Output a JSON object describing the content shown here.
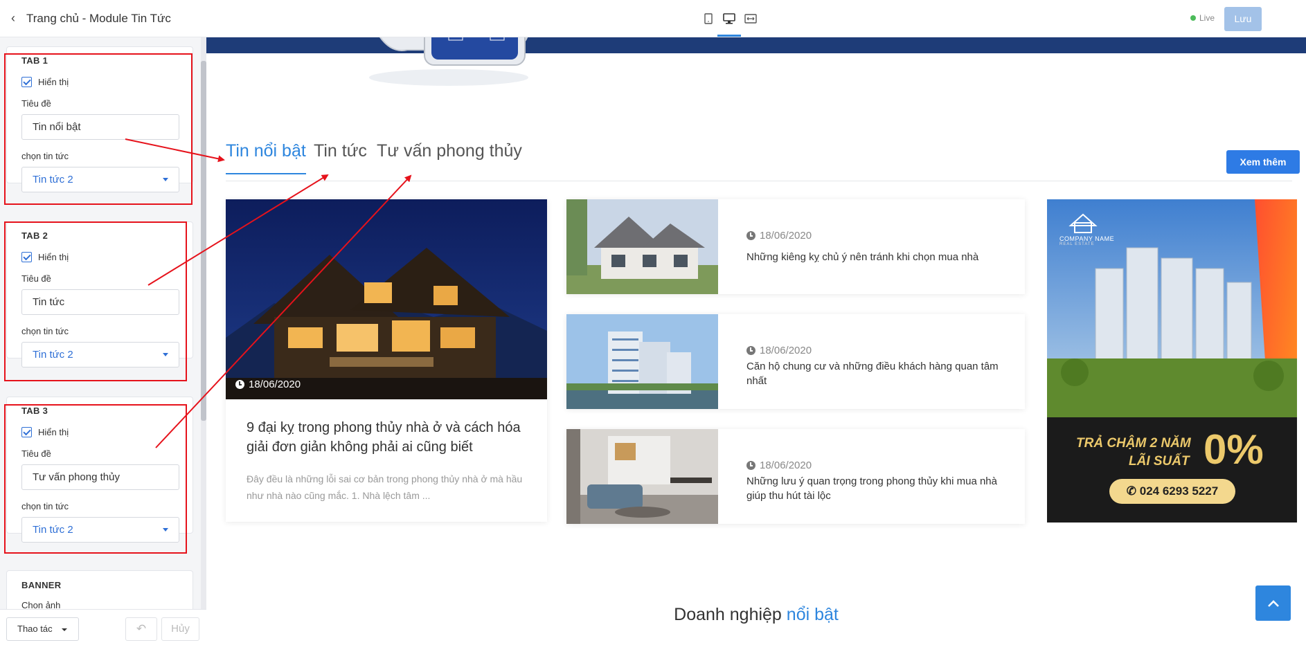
{
  "panel": {
    "title": "Trang chủ - Module Tin Tức",
    "tabs": [
      {
        "heading": "TAB 1",
        "show_label": "Hiển thị",
        "show_checked": true,
        "title_label": "Tiêu đề",
        "title_value": "Tin nổi bật",
        "select_label": "chọn tin tức",
        "select_value": "Tin tức 2"
      },
      {
        "heading": "TAB 2",
        "show_label": "Hiển thị",
        "show_checked": true,
        "title_label": "Tiêu đề",
        "title_value": "Tin tức",
        "select_label": "chọn tin tức",
        "select_value": "Tin tức 2"
      },
      {
        "heading": "TAB 3",
        "show_label": "Hiển thị",
        "show_checked": true,
        "title_label": "Tiêu đề",
        "title_value": "Tư vấn phong thủy",
        "select_label": "chọn tin tức",
        "select_value": "Tin tức 2"
      }
    ],
    "banner": {
      "heading": "BANNER",
      "image_label": "Chọn ảnh"
    },
    "footer": {
      "actions_label": "Thao tác",
      "cancel_label": "Hủy"
    }
  },
  "topbar": {
    "devices": [
      "tablet-icon",
      "desktop-icon",
      "fullwidth-icon"
    ],
    "active_device": "desktop-icon",
    "live_label": "Live",
    "save_label": "Lưu"
  },
  "preview": {
    "tabs": [
      "Tin nổi bật",
      "Tin tức",
      "Tư vấn phong thủy"
    ],
    "active_tab": 0,
    "more_label": "Xem thêm",
    "featured": {
      "date": "18/06/2020",
      "title": "9 đại kỵ trong phong thủy nhà ở và cách hóa giải đơn giản không phải ai cũng biết",
      "excerpt": "Đây đều là những lỗi sai cơ bản trong phong thủy nhà ở mà hầu như nhà nào cũng mắc. 1. Nhà lệch tâm ..."
    },
    "news": [
      {
        "date": "18/06/2020",
        "title": "Những kiêng kỵ chủ ý nên tránh khi chọn mua nhà"
      },
      {
        "date": "18/06/2020",
        "title": "Căn hộ chung cư và những điều khách hàng quan tâm nhất"
      },
      {
        "date": "18/06/2020",
        "title": "Những lưu ý quan trọng trong phong thủy khi mua nhà giúp thu hút tài lộc"
      }
    ],
    "banner": {
      "company": "COMPANY NAME",
      "tagline": "REAL ESTATE",
      "line1": "TRẢ CHẬM 2 NĂM",
      "line2": "LÃI SUẤT",
      "percent": "0%",
      "phone": "024 6293 5227"
    },
    "section2": {
      "prefix": "Doanh nghiệp",
      "highlight": "nổi bật"
    }
  },
  "colors": {
    "accent": "#2e86de",
    "annotation": "#e6121b",
    "save_disabled": "#a3c2e8",
    "banner_gold": "#ecc96b"
  }
}
